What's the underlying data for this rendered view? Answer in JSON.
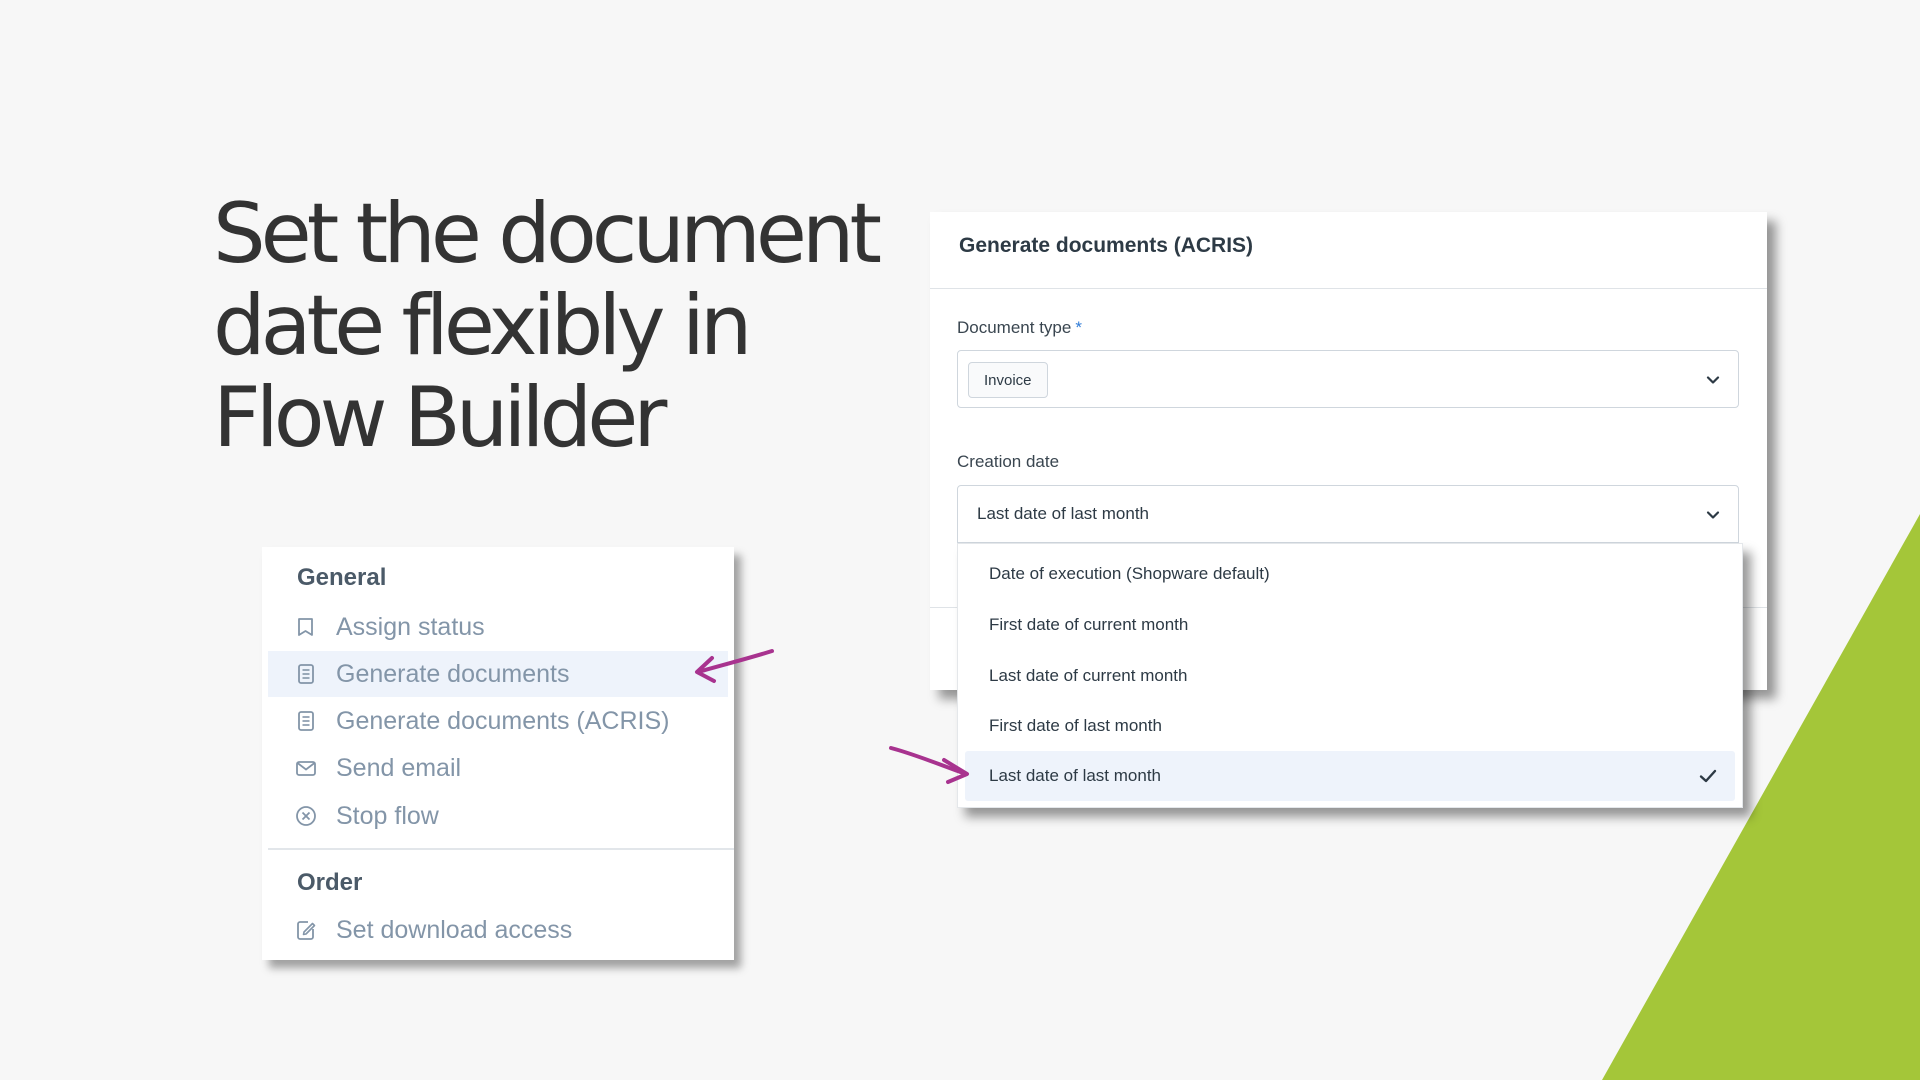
{
  "headline": {
    "line1": "Set the document",
    "line2": "date flexibly in",
    "line3": "Flow Builder"
  },
  "action_menu": {
    "groups": [
      {
        "title": "General",
        "items": [
          {
            "label": "Assign status",
            "icon": "tag-icon"
          },
          {
            "label": "Generate documents",
            "icon": "document-icon",
            "highlighted": true
          },
          {
            "label": "Generate documents (ACRIS)",
            "icon": "document-icon"
          },
          {
            "label": "Send email",
            "icon": "mail-icon"
          },
          {
            "label": "Stop flow",
            "icon": "x-circle-icon"
          }
        ]
      },
      {
        "title": "Order",
        "items": [
          {
            "label": "Set download access",
            "icon": "edit-document-icon"
          }
        ]
      }
    ]
  },
  "modal": {
    "title": "Generate documents (ACRIS)",
    "document_type": {
      "label": "Document type",
      "required_marker": "*",
      "value": "Invoice"
    },
    "creation_date": {
      "label": "Creation date",
      "value": "Last date of last month",
      "options": [
        "Date of execution (Shopware default)",
        "First date of current month",
        "Last date of current month",
        "First date of last month",
        "Last date of last month"
      ],
      "selected_index": 4
    }
  },
  "colors": {
    "accent_green": "#a4c639",
    "arrow_magenta": "#a8338f",
    "highlight_bg": "#eef3fb",
    "required_blue": "#2f7bd6"
  }
}
